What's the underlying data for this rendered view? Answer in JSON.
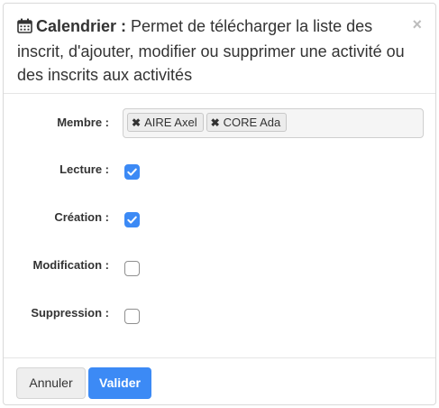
{
  "header": {
    "title_bold": "Calendrier :",
    "title_rest": " Permet de télécharger la liste des inscrit, d'ajouter, modifier ou supprimer une activité ou des inscrits aux activités",
    "close_label": "×",
    "icon": "calendar-icon"
  },
  "form": {
    "membre_label": "Membre :",
    "members": [
      {
        "remove": "✖",
        "name": "AIRE Axel"
      },
      {
        "remove": "✖",
        "name": "CORE Ada"
      }
    ],
    "permissions": [
      {
        "label": "Lecture :",
        "checked": true
      },
      {
        "label": "Création :",
        "checked": true
      },
      {
        "label": "Modification :",
        "checked": false
      },
      {
        "label": "Suppression :",
        "checked": false
      }
    ]
  },
  "footer": {
    "cancel_label": "Annuler",
    "submit_label": "Valider"
  },
  "colors": {
    "accent": "#3c8af5",
    "close": "#bdbdbd",
    "border": "#d9d9d9"
  }
}
